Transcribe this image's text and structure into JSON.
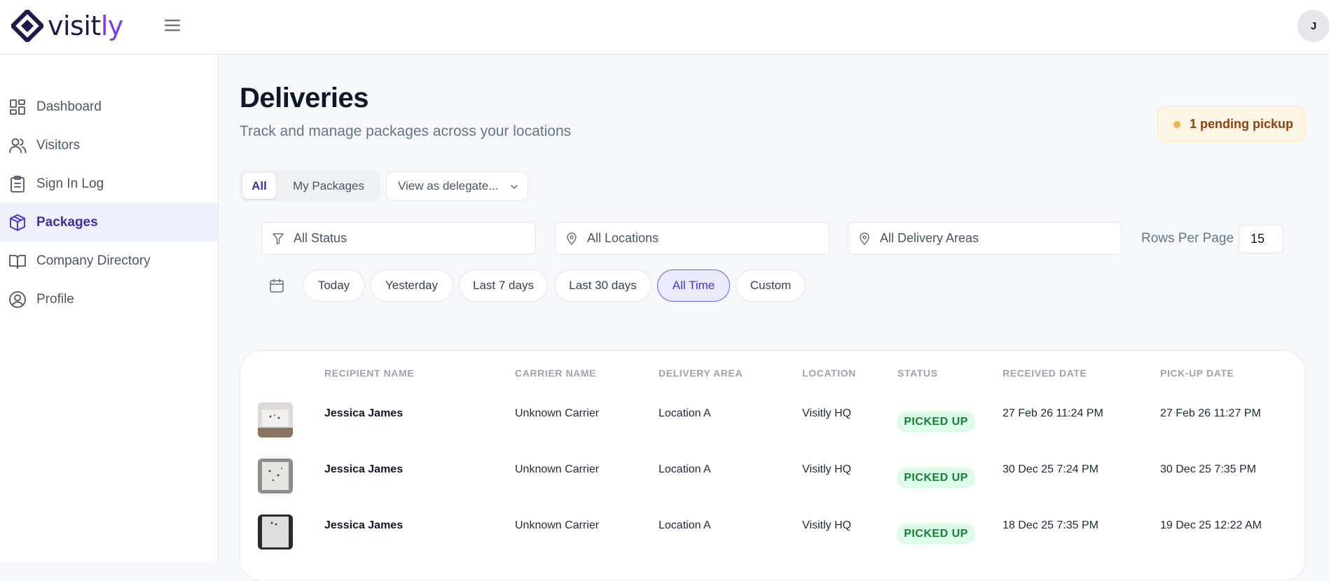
{
  "app": {
    "logo_main": "visit",
    "logo_accent": "ly",
    "avatar_initial": "J"
  },
  "sidebar": {
    "items": [
      {
        "label": "Dashboard",
        "icon": "dashboard-icon"
      },
      {
        "label": "Visitors",
        "icon": "users-icon"
      },
      {
        "label": "Sign In Log",
        "icon": "clipboard-icon"
      },
      {
        "label": "Packages",
        "icon": "package-icon",
        "active": true
      },
      {
        "label": "Company Directory",
        "icon": "book-icon"
      },
      {
        "label": "Profile",
        "icon": "user-circle-icon"
      }
    ]
  },
  "page": {
    "title": "Deliveries",
    "subtitle": "Track and manage packages across your locations",
    "pending_badge": "1 pending pickup"
  },
  "scope": {
    "all": "All",
    "mine": "My Packages",
    "delegate_placeholder": "View as delegate..."
  },
  "filters": {
    "status": "All Status",
    "locations": "All Locations",
    "areas": "All Delivery Areas",
    "rows_per_page_label": "Rows Per Page",
    "rows_per_page_value": "15"
  },
  "date_ranges": [
    {
      "label": "Today"
    },
    {
      "label": "Yesterday"
    },
    {
      "label": "Last 7 days"
    },
    {
      "label": "Last 30 days"
    },
    {
      "label": "All Time",
      "active": true
    },
    {
      "label": "Custom"
    }
  ],
  "table": {
    "columns": [
      "RECIPIENT NAME",
      "CARRIER NAME",
      "DELIVERY AREA",
      "LOCATION",
      "STATUS",
      "RECEIVED DATE",
      "PICK-UP DATE"
    ],
    "rows": [
      {
        "recipient": "Jessica James",
        "carrier": "Unknown Carrier",
        "area": "Location A",
        "location": "Visitly HQ",
        "status": "PICKED UP",
        "received": "27 Feb 26 11:24 PM",
        "pickup": "27 Feb 26 11:27 PM"
      },
      {
        "recipient": "Jessica James",
        "carrier": "Unknown Carrier",
        "area": "Location A",
        "location": "Visitly HQ",
        "status": "PICKED UP",
        "received": "30 Dec 25 7:24 PM",
        "pickup": "30 Dec 25 7:35 PM"
      },
      {
        "recipient": "Jessica James",
        "carrier": "Unknown Carrier",
        "area": "Location A",
        "location": "Visitly HQ",
        "status": "PICKED UP",
        "received": "18 Dec 25 7:35 PM",
        "pickup": "19 Dec 25 12:22 AM"
      }
    ]
  },
  "colors": {
    "brand": "#1e1b4b",
    "accent": "#7c3aed",
    "active_nav": "#3b2fb0",
    "status_picked_up_bg": "#dcfce7",
    "status_picked_up_text": "#15803d",
    "pending_bg": "#fef6e4"
  }
}
